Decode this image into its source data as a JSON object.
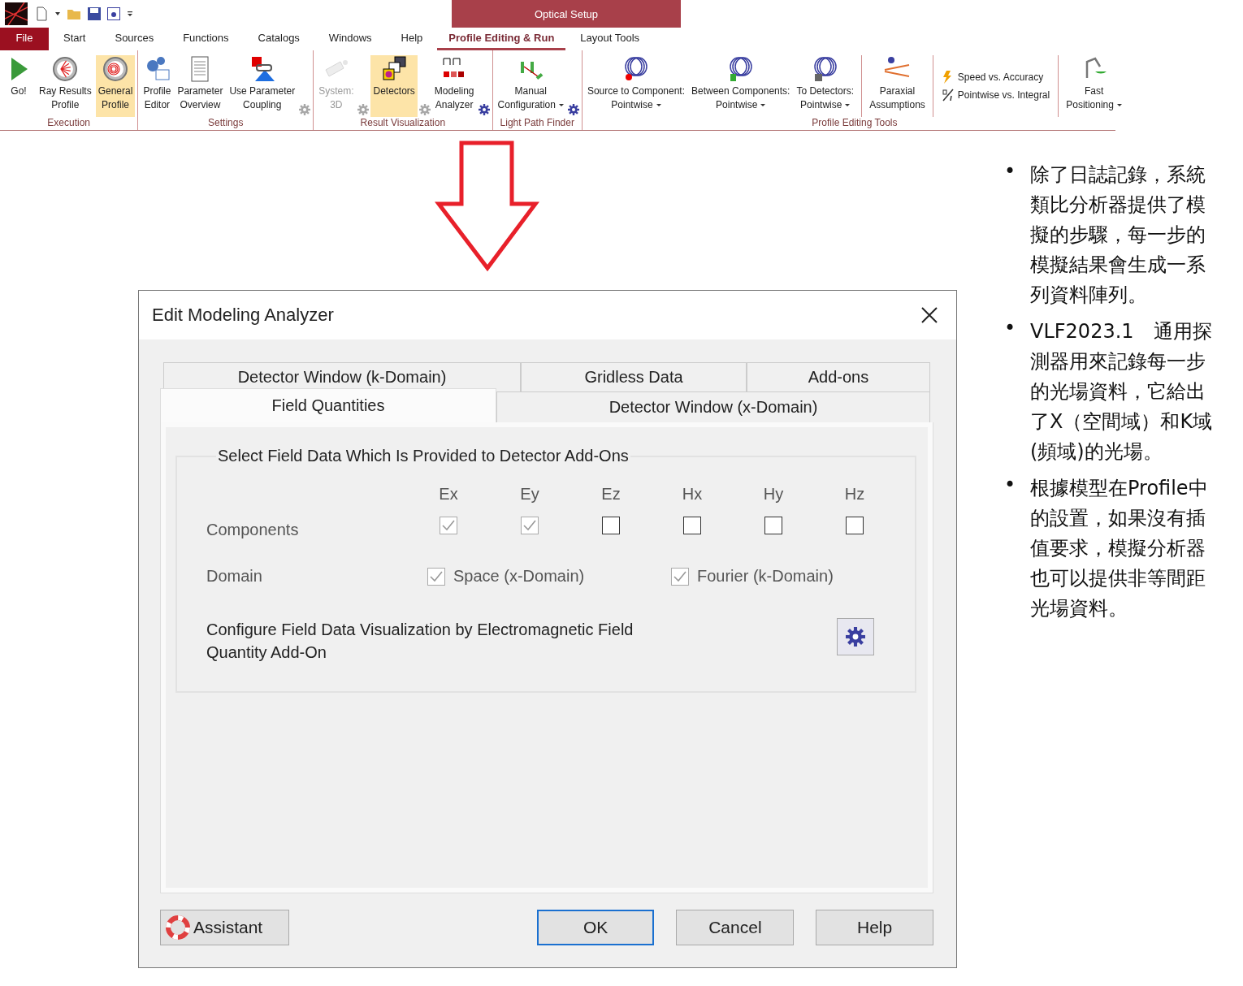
{
  "context_tab": {
    "title": "Optical Setup"
  },
  "menu_tabs": [
    {
      "label": "File",
      "kind": "file",
      "selected": false
    },
    {
      "label": "Start",
      "kind": "tab",
      "selected": false
    },
    {
      "label": "Sources",
      "kind": "tab",
      "selected": false
    },
    {
      "label": "Functions",
      "kind": "tab",
      "selected": false
    },
    {
      "label": "Catalogs",
      "kind": "tab",
      "selected": false
    },
    {
      "label": "Windows",
      "kind": "tab",
      "selected": false
    },
    {
      "label": "Help",
      "kind": "tab",
      "selected": false
    },
    {
      "label": "Profile Editing & Run",
      "kind": "tab",
      "selected": true
    },
    {
      "label": "Layout Tools",
      "kind": "tab",
      "selected": false
    }
  ],
  "ribbon_groups": [
    {
      "label": "Execution",
      "items": [
        {
          "kind": "large",
          "lines": [
            "Go!"
          ],
          "highlighted": false,
          "disabled": false,
          "dropdown": false
        },
        {
          "kind": "large",
          "lines": [
            "Ray Results",
            "Profile"
          ],
          "highlighted": false,
          "disabled": false,
          "dropdown": false
        },
        {
          "kind": "large",
          "lines": [
            "General",
            "Profile"
          ],
          "highlighted": true,
          "disabled": false,
          "dropdown": false
        }
      ]
    },
    {
      "label": "Settings",
      "items": [
        {
          "kind": "large",
          "lines": [
            "Profile",
            "Editor"
          ],
          "highlighted": false,
          "disabled": false,
          "dropdown": false
        },
        {
          "kind": "large",
          "lines": [
            "Parameter",
            "Overview"
          ],
          "highlighted": false,
          "disabled": false,
          "dropdown": false
        },
        {
          "kind": "large",
          "lines": [
            "Use Parameter",
            "Coupling"
          ],
          "highlighted": false,
          "disabled": false,
          "dropdown": false
        },
        {
          "kind": "gear",
          "disabled": true
        }
      ]
    },
    {
      "label": "Result Visualization",
      "items": [
        {
          "kind": "large",
          "lines": [
            "System:",
            "3D"
          ],
          "highlighted": false,
          "disabled": true,
          "dropdown": false
        },
        {
          "kind": "gear",
          "disabled": true
        },
        {
          "kind": "large",
          "lines": [
            "Detectors"
          ],
          "highlighted": true,
          "disabled": false,
          "dropdown": false
        },
        {
          "kind": "gear",
          "disabled": true
        },
        {
          "kind": "large",
          "lines": [
            "Modeling",
            "Analyzer"
          ],
          "highlighted": false,
          "disabled": false,
          "dropdown": false
        },
        {
          "kind": "gear",
          "disabled": false
        }
      ]
    },
    {
      "label": "Light Path Finder",
      "items": [
        {
          "kind": "large",
          "lines": [
            "Manual",
            "Configuration"
          ],
          "highlighted": false,
          "disabled": false,
          "dropdown": true
        },
        {
          "kind": "gear",
          "disabled": false
        }
      ]
    },
    {
      "label": "Profile Editing Tools",
      "items": [
        {
          "kind": "large",
          "lines": [
            "Source to Component:",
            "Pointwise"
          ],
          "highlighted": false,
          "disabled": false,
          "dropdown": true
        },
        {
          "kind": "large",
          "lines": [
            "Between Components:",
            "Pointwise"
          ],
          "highlighted": false,
          "disabled": false,
          "dropdown": true
        },
        {
          "kind": "large",
          "lines": [
            "To Detectors:",
            "Pointwise"
          ],
          "highlighted": false,
          "disabled": false,
          "dropdown": true
        },
        {
          "kind": "separator"
        },
        {
          "kind": "large",
          "lines": [
            "Paraxial",
            "Assumptions"
          ],
          "highlighted": false,
          "disabled": false,
          "dropdown": false
        },
        {
          "kind": "separator"
        },
        {
          "kind": "stack",
          "entries": [
            "Speed vs. Accuracy",
            "Pointwise vs. Integral"
          ]
        },
        {
          "kind": "separator"
        },
        {
          "kind": "large",
          "lines": [
            "Fast",
            "Positioning"
          ],
          "highlighted": false,
          "disabled": false,
          "dropdown": true
        }
      ]
    }
  ],
  "dialog": {
    "title": "Edit Modeling Analyzer",
    "tab_rows": [
      [
        {
          "label": "Detector Window (k-Domain)",
          "selected": false
        },
        {
          "label": "Gridless Data",
          "selected": false
        },
        {
          "label": "Add-ons",
          "selected": false
        }
      ],
      [
        {
          "label": "Field Quantities",
          "selected": true
        },
        {
          "label": "Detector Window (x-Domain)",
          "selected": false
        }
      ]
    ],
    "group_title": "Select Field Data Which Is Provided to Detector Add-Ons",
    "components_label": "Components",
    "components": [
      {
        "label": "Ex",
        "checked": true,
        "disabled": true
      },
      {
        "label": "Ey",
        "checked": true,
        "disabled": true
      },
      {
        "label": "Ez",
        "checked": false,
        "disabled": false
      },
      {
        "label": "Hx",
        "checked": false,
        "disabled": false
      },
      {
        "label": "Hy",
        "checked": false,
        "disabled": false
      },
      {
        "label": "Hz",
        "checked": false,
        "disabled": false
      }
    ],
    "domain_label": "Domain",
    "domains": [
      {
        "label": "Space (x-Domain)",
        "checked": true,
        "disabled": true
      },
      {
        "label": "Fourier (k-Domain)",
        "checked": true,
        "disabled": true
      }
    ],
    "configure_text": "Configure Field Data Visualization by Electromagnetic Field Quantity Add-On",
    "buttons": [
      {
        "label": "Assistant",
        "kind": "assistant",
        "default": false
      },
      {
        "label": "OK",
        "kind": "plain",
        "default": true
      },
      {
        "label": "Cancel",
        "kind": "plain",
        "default": false
      },
      {
        "label": "Help",
        "kind": "plain",
        "default": false
      }
    ]
  },
  "notes": [
    {
      "bullet": "•",
      "text": "除了日誌記錄，系統類比分析器提供了模擬的步驟，每一步的模擬結果會生成一系列資料陣列。"
    },
    {
      "bullet": "•",
      "text": "VLF2023.1　通用探測器用來記錄每一步的光場資料，它給出了X（空間域）和K域(頻域)的光場。"
    },
    {
      "bullet": "•",
      "text": "根據模型在Profile中的設置，如果沒有插值要求，模擬分析器也可以提供非等間距光場資料。"
    }
  ]
}
